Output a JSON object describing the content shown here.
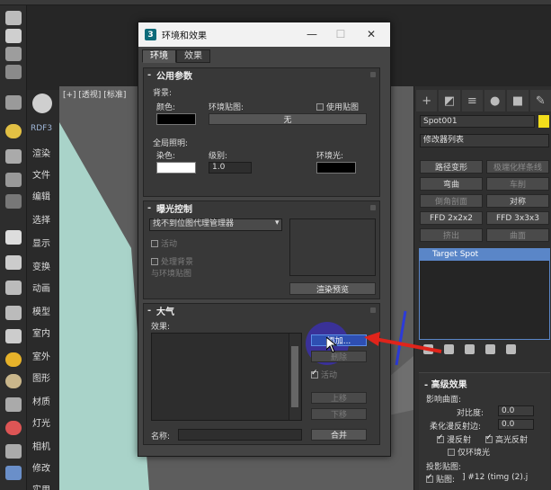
{
  "dialog": {
    "title": "环境和效果",
    "tabs": [
      "环境",
      "效果"
    ],
    "common": {
      "header": "公用参数",
      "sign": "-",
      "background_label": "背景:",
      "color_label": "颜色:",
      "env_map_label": "环境贴图:",
      "use_map_label": "使用贴图",
      "env_map_value": "无",
      "global_label": "全局照明:",
      "tint_label": "染色:",
      "level_label": "级别:",
      "level_value": "1.0",
      "ambient_label": "环境光:"
    },
    "exposure": {
      "header": "曝光控制",
      "sign": "-",
      "dropdown": "找不到位图代理管理器",
      "active_label": "活动",
      "process_label": "处理背景\n与环境贴图",
      "render_preview": "渲染预览"
    },
    "atmosphere": {
      "header": "大气",
      "sign": "-",
      "effects_label": "效果:",
      "add": "添加...",
      "delete": "删除",
      "active_label": "活动",
      "move_up": "上移",
      "move_down": "下移",
      "name_label": "名称:",
      "merge": "合并"
    }
  },
  "left_panel": {
    "logo_label": "RDF3",
    "items": [
      "渲染",
      "文件",
      "编辑",
      "选择",
      "显示",
      "变换",
      "动画",
      "模型",
      "室内",
      "室外",
      "图形",
      "材质",
      "灯光",
      "相机",
      "修改",
      "实用"
    ]
  },
  "viewport": {
    "label": "[+] [透视] [标准]"
  },
  "right_panel": {
    "object_name": "Spot001",
    "object_color": "#f2dd1b",
    "modifier_list": "修改器列表",
    "buttons": [
      "路径变形",
      "极端化样条线",
      "弯曲",
      "车削",
      "倒角剖面",
      "对称",
      "FFD 2x2x2",
      "FFD 3x3x3",
      "挤出",
      "曲面"
    ],
    "stack_item": "Target Spot",
    "advanced": {
      "header": "高级效果",
      "affect_label": "影响曲面:",
      "contrast_label": "对比度:",
      "contrast_value": "0.0",
      "soften_label": "柔化漫反射边:",
      "soften_value": "0.0",
      "diffuse_label": "漫反射",
      "specular_label": "高光反射",
      "ambient_only_label": "仅环境光",
      "projector_label": "投影贴图:",
      "map_label": "贴图:",
      "map_value": "] #12 (timg (2).j"
    }
  },
  "colors": {
    "accent_blue": "#5a86c8",
    "annotation_red": "#e0241b",
    "highlight_purple": "#3b2fb8"
  }
}
